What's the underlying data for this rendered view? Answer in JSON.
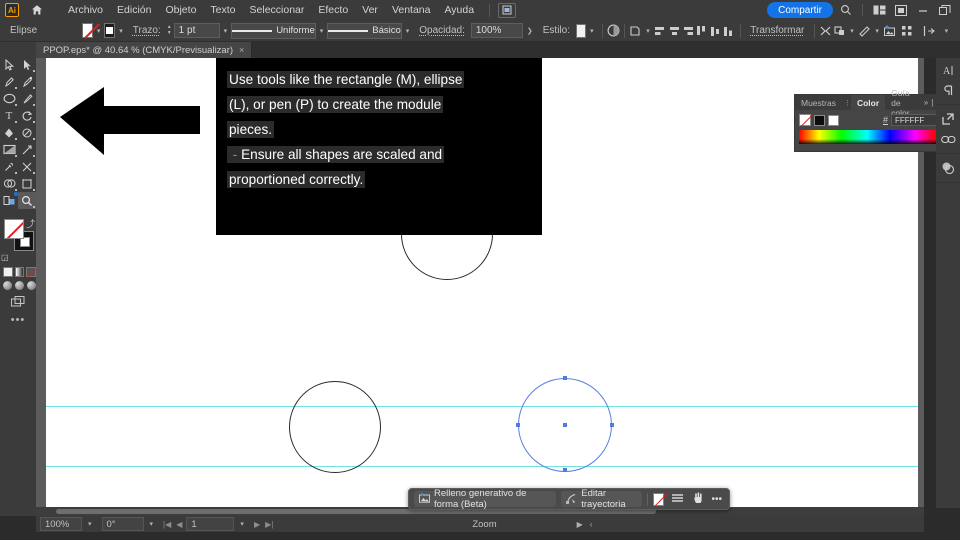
{
  "app": {
    "logo_text": "Ai",
    "home_icon": "home-icon",
    "document_icon": "document-setup-icon"
  },
  "menubar": {
    "items": [
      "Archivo",
      "Edición",
      "Objeto",
      "Texto",
      "Seleccionar",
      "Efecto",
      "Ver",
      "Ventana",
      "Ayuda"
    ],
    "share_label": "Compartir",
    "search_icon": "search-icon",
    "workspace_icon": "workspace-switcher-icon",
    "arrange_icon": "arrange-documents-icon",
    "minimize_icon": "minimize-icon",
    "restore_icon": "restore-icon"
  },
  "controlbar": {
    "selection_label": "Elipse",
    "fill_swatch": "none",
    "stroke_swatch": "black",
    "stroke_label": "Trazo:",
    "stroke_weight": "1 pt",
    "stroke_profile": "Uniforme",
    "brush_definition": "Básico",
    "opacity_label": "Opacidad:",
    "opacity_value": "100%",
    "style_label": "Estilo:",
    "icons": [
      "recolor-artwork-icon",
      "select-similar-icon",
      "align-left-icon",
      "align-center-horizontal-icon",
      "align-right-icon",
      "align-top-icon",
      "align-center-vertical-icon",
      "align-bottom-icon"
    ],
    "transform_label": "Transformar",
    "shape_builder_icon": "shape-builder-icon",
    "isolate_icon": "isolate-group-icon",
    "mask_icon": "make-mask-icon",
    "generative_icon": "generative-fill-icon",
    "snap_icon": "snap-to-grid-icon",
    "distribute_icon": "distribute-spacing-icon"
  },
  "document": {
    "tab_title": "PPOP.eps* @ 40.64 % (CMYK/Previsualizar)",
    "tab_close": "×"
  },
  "toolbar": {
    "tools": [
      {
        "name": "selection-tool",
        "glyph": "▷"
      },
      {
        "name": "direct-selection-tool",
        "glyph": "▶"
      },
      {
        "name": "pen-tool",
        "glyph": "✒"
      },
      {
        "name": "curvature-tool",
        "glyph": "✎"
      },
      {
        "name": "ellipse-tool",
        "glyph": "◯",
        "active": true
      },
      {
        "name": "paintbrush-tool",
        "glyph": "🖌"
      },
      {
        "name": "type-tool",
        "glyph": "T"
      },
      {
        "name": "rotate-tool",
        "glyph": "↻"
      },
      {
        "name": "gradient-tool",
        "glyph": "◧"
      },
      {
        "name": "eyedropper-group-icon",
        "glyph": "❧"
      },
      {
        "name": "rectangle-tool",
        "glyph": "▭"
      },
      {
        "name": "scale-tool",
        "glyph": "⤢"
      },
      {
        "name": "eyedropper-tool",
        "glyph": "⌇"
      },
      {
        "name": "blend-tool",
        "glyph": "✂"
      },
      {
        "name": "shape-builder-tool",
        "glyph": "◕"
      },
      {
        "name": "artboard-tool",
        "glyph": "⊞"
      },
      {
        "name": "slice-tool",
        "glyph": "⌗"
      },
      {
        "name": "zoom-tool",
        "glyph": "🔍"
      }
    ],
    "fill_name": "fill-swatch-none",
    "stroke_name": "stroke-swatch-black",
    "swap_icon": "swap-fill-stroke-icon",
    "default_icon": "default-fill-stroke-icon",
    "draw_modes": [
      "draw-normal-icon",
      "draw-behind-icon",
      "draw-inside-icon"
    ],
    "screen_mode_icon": "screen-mode-icon",
    "more_tools_icon": "edit-toolbar-icon"
  },
  "canvas": {
    "guides_note": "smart-guides",
    "shapes": [
      {
        "name": "circle-top",
        "selected": false
      },
      {
        "name": "circle-left",
        "selected": false
      },
      {
        "name": "circle-right-selected",
        "selected": true
      }
    ]
  },
  "context_toolbar": {
    "generative_fill_label": "Relleno generativo de forma (Beta)",
    "generative_fill_icon": "generative-fill-icon",
    "edit_path_label": "Editar trayectoria",
    "edit_path_icon": "edit-path-icon",
    "fill_swatch_icon": "fill-swatch-none-icon",
    "stroke_options_icon": "stroke-lines-icon",
    "hand_icon": "hand-icon",
    "more_icon": "more-options-icon"
  },
  "statusbar": {
    "zoom_value": "100%",
    "rotation_value": "0°",
    "artboard_value": "1",
    "zoom_tool_label": "Zoom",
    "first_icon": "first-artboard-icon",
    "prev_icon": "previous-artboard-icon",
    "next_icon": "next-artboard-icon",
    "last_icon": "last-artboard-icon",
    "play_icon": "play-icon"
  },
  "color_panel": {
    "tabs": [
      {
        "label": "Muestras",
        "active": false
      },
      {
        "label": "Color",
        "active": true
      },
      {
        "label": "Guía de color",
        "active": false
      }
    ],
    "collapse_icon": "»",
    "menu_icon": "≡",
    "hash_symbol": "#",
    "hex_value": "FFFFFF",
    "swatches": [
      "none",
      "black",
      "white"
    ],
    "spectrum_name": "color-spectrum-ramp"
  },
  "panel_dock": {
    "icons": [
      {
        "name": "character-panel-icon",
        "glyph": "A",
        "label": ""
      },
      {
        "name": "paragraph-panel-icon",
        "glyph": "¶",
        "label": ""
      },
      {
        "name": "asset-export-panel-icon",
        "glyph": "⇱",
        "label": ""
      },
      {
        "name": "links-panel-icon",
        "glyph": "⛓",
        "label": ""
      },
      {
        "name": "appearance-panel-icon",
        "glyph": "◑",
        "label": ""
      }
    ]
  },
  "annotation": {
    "lines": [
      "Use tools like the rectangle (M), ellipse",
      "(L), or pen (P) to create the module",
      "pieces.",
      "- Ensure all shapes are scaled and",
      "proportioned correctly."
    ],
    "line1": "Use tools like the rectangle (M), ellipse",
    "line2": "(L), or pen (P) to create the module",
    "line3": "pieces.",
    "line4_dash": "-",
    "line4": "Ensure all shapes are scaled and",
    "line5": "proportioned correctly.",
    "arrow_name": "pointer-arrow-annotation",
    "arrow_direction": "left"
  }
}
